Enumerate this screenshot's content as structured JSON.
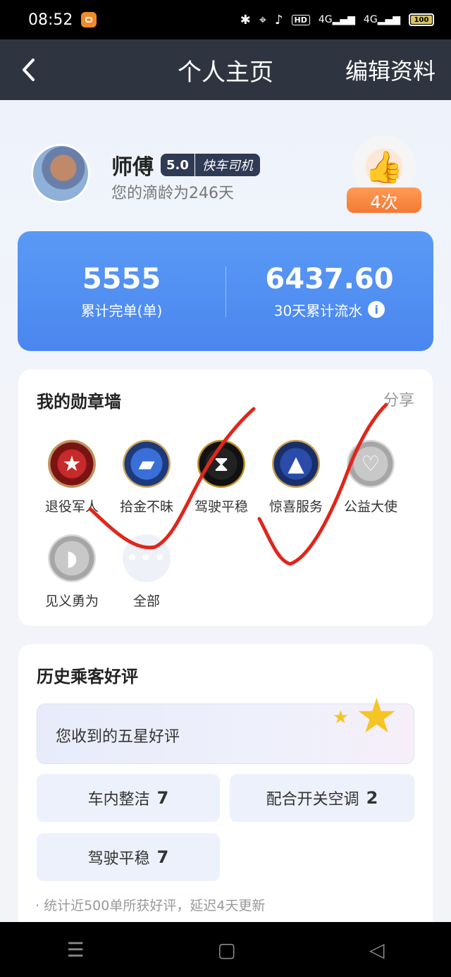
{
  "status_bar": {
    "time": "08:52",
    "network_labels": [
      "HD",
      "4G",
      "4G"
    ],
    "battery": "100"
  },
  "nav": {
    "back_icon": "chevron-left-icon",
    "title": "个人主页",
    "edit_label": "编辑资料"
  },
  "profile": {
    "name": "师傅",
    "rating": "5.0",
    "driver_type": "快车司机",
    "age_text": "您的滴龄为246天",
    "thumbs_count": "4次"
  },
  "stats": {
    "orders_value": "5555",
    "orders_label": "累计完单(单)",
    "flow_value": "6437.60",
    "flow_label": "30天累计流水"
  },
  "medals": {
    "title": "我的勋章墙",
    "share_label": "分享",
    "items": [
      {
        "name": "退役军人",
        "icon": "star-medal-icon"
      },
      {
        "name": "拾金不昧",
        "icon": "wallet-medal-icon"
      },
      {
        "name": "驾驶平稳",
        "icon": "hourglass-medal-icon"
      },
      {
        "name": "惊喜服务",
        "icon": "thumbs-up-medal-icon"
      },
      {
        "name": "公益大使",
        "icon": "heart-medal-icon"
      },
      {
        "name": "见义勇为",
        "icon": "arm-medal-icon"
      },
      {
        "name": "全部",
        "icon": "more-icon"
      }
    ]
  },
  "reviews": {
    "title": "历史乘客好评",
    "five_star_label": "您收到的五星好评",
    "tags": [
      {
        "label": "车内整洁",
        "count": "7"
      },
      {
        "label": "配合开关空调",
        "count": "2"
      },
      {
        "label": "驾驶平稳",
        "count": "7"
      }
    ],
    "footnote": "· 统计近500单所获好评，延迟4天更新"
  },
  "colors": {
    "stats_card": "#4a86ef",
    "annotation": "#e0261c",
    "nav_bg": "#2f3540"
  }
}
